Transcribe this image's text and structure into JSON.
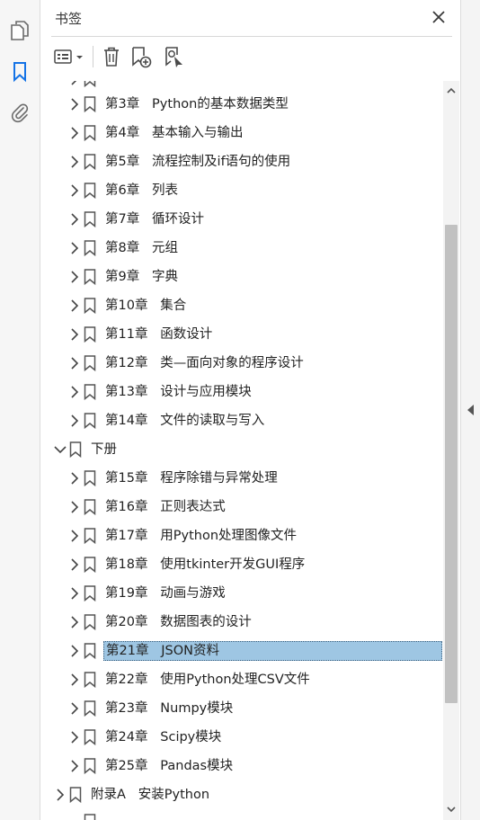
{
  "panel": {
    "title": "书签"
  },
  "rail": {
    "icons": [
      "pages-icon",
      "bookmark-icon",
      "attachment-icon"
    ]
  },
  "toolbar": {
    "icons": [
      "options-menu-icon",
      "delete-bookmark-icon",
      "new-bookmark-icon",
      "find-bookmark-icon"
    ]
  },
  "colors": {
    "selected_bg": "#9ec6e3",
    "accent_blue": "#1473e6",
    "rail_bg": "#f6f6f6"
  },
  "bookmarks": [
    {
      "label": "第3章   Python的基本数据类型",
      "level": 2,
      "expanded": false,
      "selected": false
    },
    {
      "label": "第4章   基本输入与输出",
      "level": 2,
      "expanded": false,
      "selected": false
    },
    {
      "label": "第5章   流程控制及if语句的使用",
      "level": 2,
      "expanded": false,
      "selected": false
    },
    {
      "label": "第6章   列表",
      "level": 2,
      "expanded": false,
      "selected": false
    },
    {
      "label": "第7章   循环设计",
      "level": 2,
      "expanded": false,
      "selected": false
    },
    {
      "label": "第8章   元组",
      "level": 2,
      "expanded": false,
      "selected": false
    },
    {
      "label": "第9章   字典",
      "level": 2,
      "expanded": false,
      "selected": false
    },
    {
      "label": "第10章   集合",
      "level": 2,
      "expanded": false,
      "selected": false
    },
    {
      "label": "第11章   函数设计",
      "level": 2,
      "expanded": false,
      "selected": false
    },
    {
      "label": "第12章   类—面向对象的程序设计",
      "level": 2,
      "expanded": false,
      "selected": false
    },
    {
      "label": "第13章   设计与应用模块",
      "level": 2,
      "expanded": false,
      "selected": false
    },
    {
      "label": "第14章   文件的读取与写入",
      "level": 2,
      "expanded": false,
      "selected": false
    },
    {
      "label": "下册",
      "level": 1,
      "expanded": true,
      "selected": false
    },
    {
      "label": "第15章   程序除错与异常处理",
      "level": 2,
      "expanded": false,
      "selected": false
    },
    {
      "label": "第16章   正则表达式",
      "level": 2,
      "expanded": false,
      "selected": false
    },
    {
      "label": "第17章   用Python处理图像文件",
      "level": 2,
      "expanded": false,
      "selected": false
    },
    {
      "label": "第18章   使用tkinter开发GUI程序",
      "level": 2,
      "expanded": false,
      "selected": false
    },
    {
      "label": "第19章   动画与游戏",
      "level": 2,
      "expanded": false,
      "selected": false
    },
    {
      "label": "第20章   数据图表的设计",
      "level": 2,
      "expanded": false,
      "selected": false
    },
    {
      "label": "第21章   JSON资料",
      "level": 2,
      "expanded": false,
      "selected": true
    },
    {
      "label": "第22章   使用Python处理CSV文件",
      "level": 2,
      "expanded": false,
      "selected": false
    },
    {
      "label": "第23章   Numpy模块",
      "level": 2,
      "expanded": false,
      "selected": false
    },
    {
      "label": "第24章   Scipy模块",
      "level": 2,
      "expanded": false,
      "selected": false
    },
    {
      "label": "第25章   Pandas模块",
      "level": 2,
      "expanded": false,
      "selected": false
    },
    {
      "label": "附录A   安装Python",
      "level": 1,
      "expanded": false,
      "selected": false
    }
  ]
}
